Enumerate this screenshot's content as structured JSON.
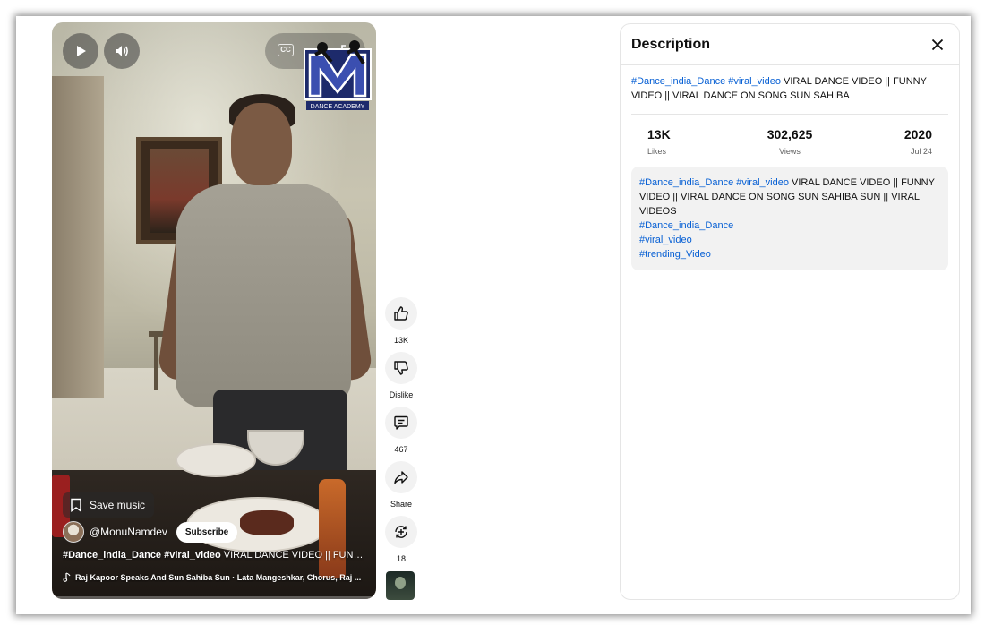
{
  "player": {
    "cc_label": "CC",
    "logo_text": "DANCE ACADEMY",
    "save_music_label": "Save music",
    "channel_name": "@MonuNamdev",
    "subscribe_label": "Subscribe",
    "caption_tags": "#Dance_india_Dance #viral_video",
    "caption_text": "VIRAL DANCE VIDEO || FUNNY ...",
    "music_text": "Raj Kapoor Speaks And Sun Sahiba Sun · Lata Mangeshkar, Chorus, Raj ...",
    "progress": 0.01
  },
  "actions": {
    "like_count": "13K",
    "dislike_label": "Dislike",
    "comment_count": "467",
    "share_label": "Share",
    "remix_count": "18"
  },
  "description": {
    "title": "Description",
    "headline_tag1": "#Dance_india_Dance",
    "headline_tag2": "#viral_video",
    "headline_text": "VIRAL DANCE VIDEO || FUNNY VIDEO || VIRAL DANCE ON SONG SUN SAHIBA",
    "stats": [
      {
        "value": "13K",
        "label": "Likes"
      },
      {
        "value": "302,625",
        "label": "Views"
      },
      {
        "value": "2020",
        "label": "Jul 24"
      }
    ],
    "body_tag1": "#Dance_india_Dance",
    "body_tag2": "#viral_video",
    "body_text": "VIRAL DANCE VIDEO || FUNNY VIDEO || VIRAL DANCE ON SONG SUN SAHIBA SUN || VIRAL VIDEOS",
    "body_hashtags": [
      "#Dance_india_Dance",
      "#viral_video",
      "#trending_Video"
    ]
  },
  "colors": {
    "link": "#065fd4",
    "progress": "#ff0000"
  }
}
